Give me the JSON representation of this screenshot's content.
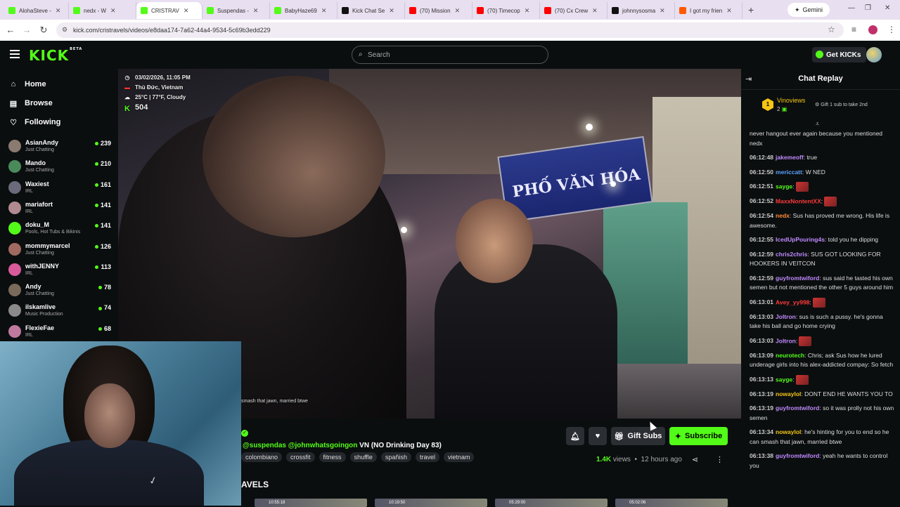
{
  "browser": {
    "tabs": [
      {
        "label": "AlohaSteve -",
        "color": "#53fc18",
        "active": false
      },
      {
        "label": "nedx - W",
        "color": "#53fc18",
        "active": false
      },
      {
        "label": "CRISTRAV",
        "color": "#53fc18",
        "active": true
      },
      {
        "label": "Suspendas -",
        "color": "#53fc18",
        "active": false
      },
      {
        "label": "BabyHaze69",
        "color": "#53fc18",
        "active": false
      },
      {
        "label": "Kick Chat Se",
        "color": "#111111",
        "active": false
      },
      {
        "label": "(70) Mission",
        "color": "#ff0000",
        "active": false
      },
      {
        "label": "(70) Timecop",
        "color": "#ff0000",
        "active": false
      },
      {
        "label": "(70) Cx Crew",
        "color": "#ff0000",
        "active": false
      },
      {
        "label": "johnnysosma",
        "color": "#111111",
        "active": false
      },
      {
        "label": "I got my frien",
        "color": "#ff5a00",
        "active": false
      }
    ],
    "gemini_label": "Gemini",
    "url": "kick.com/cristravels/videos/e8daa174-7a62-44a4-9534-5c69b3edd229"
  },
  "header": {
    "logo": "KICK",
    "logo_beta": "BETA",
    "search_placeholder": "Search",
    "get_kicks": "Get KICKs"
  },
  "sidebar": {
    "nav": [
      {
        "label": "Home",
        "icon": "home-icon"
      },
      {
        "label": "Browse",
        "icon": "browse-icon"
      },
      {
        "label": "Following",
        "icon": "heart-icon"
      }
    ],
    "channels": [
      {
        "name": "AsianAndy",
        "category": "Just Chatting",
        "viewers": "239",
        "color": "#8a7a70"
      },
      {
        "name": "Mando",
        "category": "Just Chatting",
        "viewers": "210",
        "color": "#4a8a5a"
      },
      {
        "name": "Waxiest",
        "category": "IRL",
        "viewers": "161",
        "color": "#6a6a7a"
      },
      {
        "name": "mariafort",
        "category": "IRL",
        "viewers": "141",
        "color": "#b08a90"
      },
      {
        "name": "doku_M",
        "category": "Pools, Hot Tubs & Bikinis",
        "viewers": "141",
        "color": "#53fc18"
      },
      {
        "name": "mommymarcel",
        "category": "Just Chatting",
        "viewers": "126",
        "color": "#a06a60"
      },
      {
        "name": "withJENNY",
        "category": "IRL",
        "viewers": "113",
        "color": "#d85a9a"
      },
      {
        "name": "Andy",
        "category": "Just Chatting",
        "viewers": "78",
        "color": "#7a6a5a"
      },
      {
        "name": "ilskamlive",
        "category": "Music Production",
        "viewers": "74",
        "color": "#8a8a8a"
      },
      {
        "name": "FlexieFae",
        "category": "IRL",
        "viewers": "68",
        "color": "#c07aa0"
      }
    ]
  },
  "overlay": {
    "datetime": "03/02/2026, 11:05 PM",
    "location": "Thủ Đức, Vietnam",
    "weather": "25°C | 77°F, Cloudy",
    "viewers": "504",
    "sign_text": "PHỐ VĂN HÓA",
    "caption": "smash that jawn, married btwe"
  },
  "stream": {
    "title_mentions": "@suspendas @johnwhatsgoingon",
    "title_rest": " VN (NO Drinking Day 83)",
    "tags": [
      "colombiano",
      "crossfit",
      "fitness",
      "shuffle",
      "spañish",
      "travel",
      "vietnam"
    ],
    "gift_label": "Gift Subs",
    "subscribe_label": "Subscribe",
    "views_count": "1.4K",
    "views_word": "views",
    "time_ago": "12 hours ago",
    "section_heading": "AVELS",
    "thumb_durations": [
      "10:55:18",
      "10:19:50",
      "05:29:00",
      "05:02:06"
    ]
  },
  "chat": {
    "title": "Chat Replay",
    "pinned": {
      "rank": "1",
      "name": "Vinoviews",
      "count": "2",
      "note": "Gift 1 sub to take 2nd"
    },
    "messages": [
      {
        "time": "",
        "user": "",
        "color": "#ddd",
        "text": "never hangout ever again because you mentioned nedx"
      },
      {
        "time": "06:12:48",
        "user": "jakemeoff",
        "color": "#c08aff",
        "text": ": true"
      },
      {
        "time": "06:12:50",
        "user": "mericcatt",
        "color": "#5aa0ff",
        "text": ": W NED"
      },
      {
        "time": "06:12:51",
        "user": "sayge",
        "color": "#53fc18",
        "text": ":"
      },
      {
        "time": "06:12:52",
        "user": "MaxxNontentXX",
        "color": "#ff3a3a",
        "text": ":"
      },
      {
        "time": "06:12:54",
        "user": "nedx",
        "color": "#ff8a3a",
        "text": ": Sus has proved me wrong. His life is awesome."
      },
      {
        "time": "06:12:55",
        "user": "IcedUpPouring4s",
        "color": "#c08aff",
        "text": ": told you he dipping"
      },
      {
        "time": "06:12:59",
        "user": "chris2chris",
        "color": "#c08aff",
        "text": ": SUS GOT LOOKING FOR HOOKERS IN VEITCON"
      },
      {
        "time": "06:12:59",
        "user": "guyfromtwiford",
        "color": "#c08aff",
        "text": ": sus said he tasted his own semen but not mentioned the other 5 guys around him"
      },
      {
        "time": "06:13:01",
        "user": "Avey_yy998",
        "color": "#ff3a3a",
        "text": ":"
      },
      {
        "time": "06:13:03",
        "user": "Joltron",
        "color": "#c08aff",
        "text": ": sus is such a pussy. he's gonna take his ball and go home crying"
      },
      {
        "time": "06:13:03",
        "user": "Joltron",
        "color": "#c08aff",
        "text": ":"
      },
      {
        "time": "06:13:09",
        "user": "neurotech",
        "color": "#53fc18",
        "text": ": Chris; ask Sus how he lured underage girls into his alex-addicted compay: So fetch"
      },
      {
        "time": "06:13:13",
        "user": "sayge",
        "color": "#53fc18",
        "text": ":"
      },
      {
        "time": "06:13:19",
        "user": "nowaylol",
        "color": "#f3c613",
        "text": ": DONT END HE WANTS YOU TO"
      },
      {
        "time": "06:13:19",
        "user": "guyfromtwiford",
        "color": "#c08aff",
        "text": ": so it was prolly not his own semen"
      },
      {
        "time": "06:13:34",
        "user": "nowaylol",
        "color": "#f3c613",
        "text": ": he's hinting for you to end so he can smash that jawn, married btwe"
      },
      {
        "time": "06:13:38",
        "user": "guyfromtwiford",
        "color": "#c08aff",
        "text": ": yeah he wants to control you"
      }
    ]
  }
}
